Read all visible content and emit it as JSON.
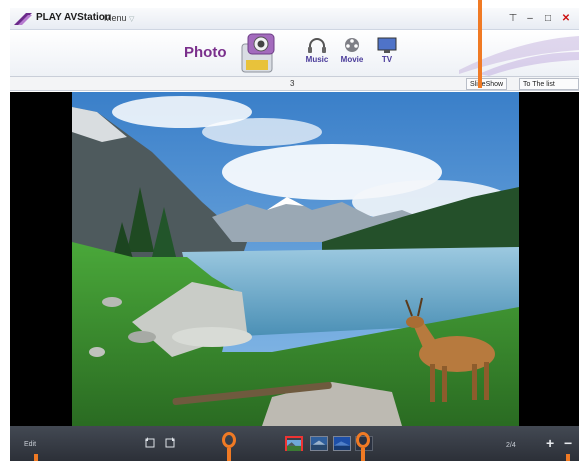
{
  "window": {
    "app_title": "PLAY AVStation",
    "menu_label": "Menu",
    "controls": {
      "restore": "⊤",
      "minimize": "–",
      "maximize": "□",
      "close": "✕"
    }
  },
  "categories": {
    "active": "Photo",
    "items": [
      {
        "label": "Music",
        "icon": "headphones-icon"
      },
      {
        "label": "Movie",
        "icon": "film-reel-icon"
      },
      {
        "label": "TV",
        "icon": "tv-icon"
      }
    ]
  },
  "toolbar": {
    "counter": "3",
    "slideshow_label": "SlideShow",
    "list_screen_label": "To The list Screen"
  },
  "viewer": {
    "image_description_icon": "landscape-photo"
  },
  "bottombar": {
    "edit_label": "Edit",
    "rotate_left_icon": "rotate-left-icon",
    "rotate_right_icon": "rotate-right-icon",
    "thumbnails": [
      {
        "state": "selected"
      },
      {
        "state": "normal"
      },
      {
        "state": "normal"
      },
      {
        "state": "normal"
      }
    ],
    "zoom_label": "2/4",
    "zoom_in": "+",
    "zoom_out": "−"
  },
  "colors": {
    "callout": "#f07a24",
    "accent_purple": "#7a2f8c",
    "selection_red": "#e33333"
  }
}
